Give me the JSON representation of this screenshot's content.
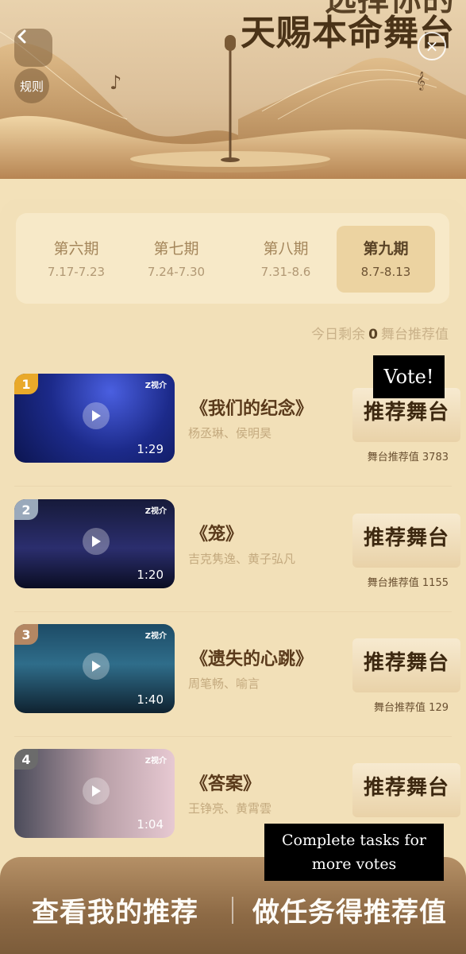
{
  "hero": {
    "title_line1": "选择你的",
    "title_line2": "天赐本命舞台",
    "back_icon": "chevron-left-icon",
    "rules_label": "规则",
    "close_icon": "close-icon"
  },
  "periods": [
    {
      "name": "第六期",
      "date": "7.17-7.23",
      "active": false
    },
    {
      "name": "第七期",
      "date": "7.24-7.30",
      "active": false
    },
    {
      "name": "第八期",
      "date": "7.31-8.6",
      "active": false
    },
    {
      "name": "第九期",
      "date": "8.7-8.13",
      "active": true
    }
  ],
  "remaining": {
    "prefix": "今日剩余",
    "count": "0",
    "suffix": "舞台推荐值"
  },
  "items": [
    {
      "rank": "1",
      "song": "《我们的纪念》",
      "artists": "杨丞琳、侯明昊",
      "duration": "1:29",
      "button": "推荐舞台",
      "value_label": "舞台推荐值",
      "value": "3783",
      "rank_color": "#e9a92a"
    },
    {
      "rank": "2",
      "song": "《笼》",
      "artists": "吉克隽逸、黄子弘凡",
      "duration": "1:20",
      "button": "推荐舞台",
      "value_label": "舞台推荐值",
      "value": "1155",
      "rank_color": "#9aa9bb"
    },
    {
      "rank": "3",
      "song": "《遗失的心跳》",
      "artists": "周笔畅、喻言",
      "duration": "1:40",
      "button": "推荐舞台",
      "value_label": "舞台推荐值",
      "value": "129",
      "rank_color": "#b48763"
    },
    {
      "rank": "4",
      "song": "《答案》",
      "artists": "王铮亮、黄霄雲",
      "duration": "1:04",
      "button": "推荐舞台",
      "value_label": "",
      "value": "",
      "rank_color": "#6b6b6b"
    }
  ],
  "thumb_logo": "Z视介",
  "overlays": {
    "vote": "Vote!",
    "tasks_line1": "Complete tasks for",
    "tasks_line2": "more votes"
  },
  "bottom": {
    "left_label": "查看我的推荐",
    "right_label": "做任务得推荐值"
  },
  "colors": {
    "accent": "#5a4326",
    "panel": "#f2e0b8",
    "bottom_bar": "#8d6a45"
  }
}
